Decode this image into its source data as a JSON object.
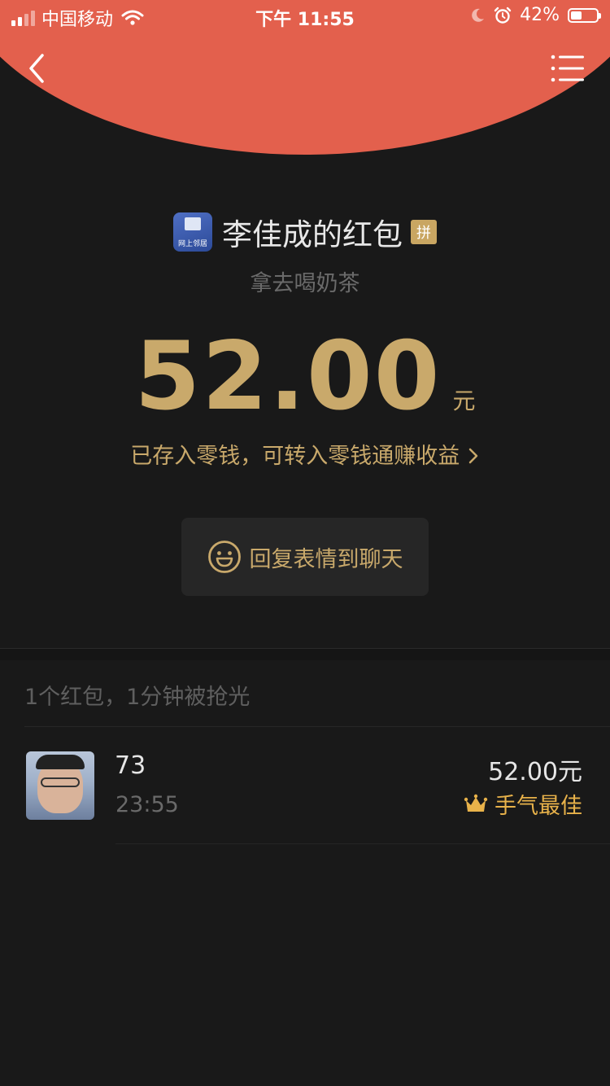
{
  "status_bar": {
    "carrier": "中国移动",
    "time": "下午 11:55",
    "battery": "42%",
    "battery_level": 0.42
  },
  "nav": {
    "back_icon": "chevron-left-icon",
    "menu_icon": "list-icon"
  },
  "packet": {
    "sender_avatar_text": "网上邻居",
    "sender_title": "李佳成的红包",
    "pin_badge": "拼",
    "greeting": "拿去喝奶茶",
    "amount": "52.00",
    "unit": "元",
    "deposit_link": "已存入零钱，可转入零钱通赚收益 ",
    "reply_label": "回复表情到聊天"
  },
  "summary": "1个红包，1分钟被抢光",
  "records": [
    {
      "name": "73",
      "time": "23:55",
      "amount": "52.00元",
      "badge": "手气最佳"
    }
  ],
  "colors": {
    "header_red": "#e3604d",
    "gold": "#c9a96b",
    "best_gold": "#e8b24a",
    "background": "#191919"
  }
}
